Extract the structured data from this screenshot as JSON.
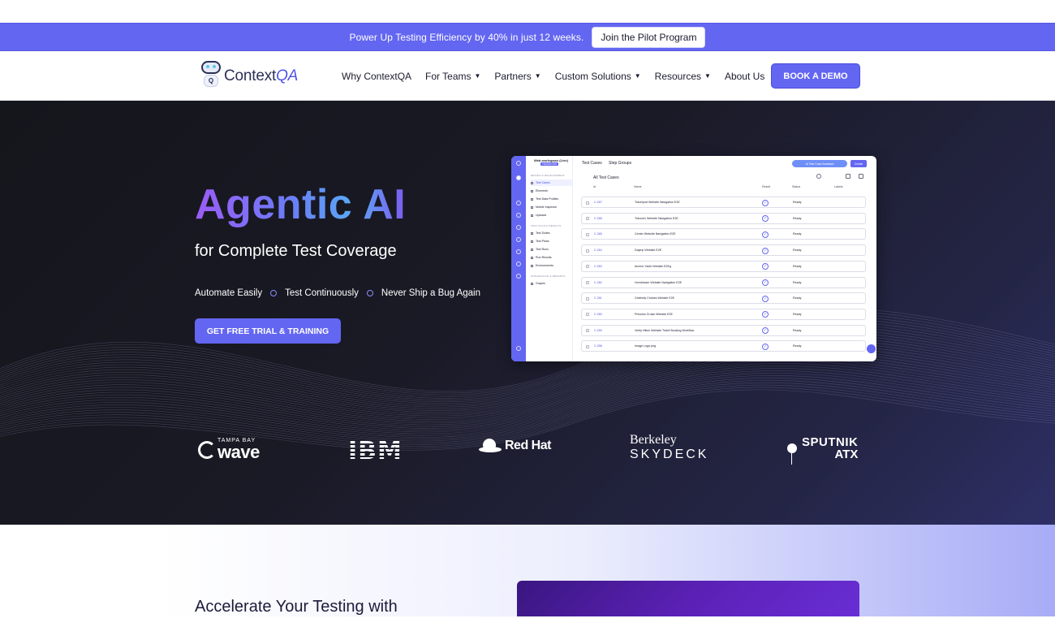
{
  "promo": {
    "text": "Power Up Testing Efficiency by 40% in just 12 weeks.",
    "button": "Join the Pilot Program"
  },
  "nav": {
    "logo_text_1": "Context",
    "logo_text_2": "QA",
    "logo_badge": "Q",
    "links": [
      {
        "label": "Why ContextQA",
        "dropdown": false
      },
      {
        "label": "For Teams",
        "dropdown": true
      },
      {
        "label": "Partners",
        "dropdown": true
      },
      {
        "label": "Custom Solutions",
        "dropdown": true
      },
      {
        "label": "Resources",
        "dropdown": true
      },
      {
        "label": "About Us",
        "dropdown": false
      }
    ],
    "demo_button": "BOOK A DEMO"
  },
  "hero": {
    "title": "Agentic AI",
    "subtitle": "for Complete Test Coverage",
    "points": [
      "Automate Easily",
      "Test Continuously",
      "Never Ship a Bug Again"
    ],
    "cta": "GET FREE TRIAL & TRAINING"
  },
  "app": {
    "workspace": "Web workspace (Live)",
    "workspace_badge": "TRANSITION",
    "tabs": [
      "Test Cases",
      "Step Groups"
    ],
    "ai_button": "AI Test Case Assistant",
    "create_button": "Create",
    "section_1": "DESIGN & DEVELOPMENT",
    "section_1_items": [
      "Test Cases",
      "Elements",
      "Test Data Profiles",
      "Mobile Inspector",
      "Uploads"
    ],
    "section_2": "TEST PLAN & RESULTS",
    "section_2_items": [
      "Test Suites",
      "Test Plans",
      "Test Runs",
      "Run Results",
      "Environments"
    ],
    "section_3": "INTEGRATION & REPORTS",
    "section_3_items": [
      "Graphs"
    ],
    "list_title": "All Test Cases",
    "columns": [
      "Id",
      "Name",
      "Result",
      "Status",
      "Labels"
    ],
    "rows": [
      {
        "id": "C-267",
        "name": "Travelport Website Navigation E2E",
        "status": "Ready"
      },
      {
        "id": "C-266",
        "name": "Travurex Website Navigation E2E",
        "status": "Ready"
      },
      {
        "id": "C-265",
        "name": "Center Website Navigation E2E",
        "status": "Ready"
      },
      {
        "id": "C-264",
        "name": "Daytrip Website E2E",
        "status": "Ready"
      },
      {
        "id": "C-263",
        "name": "Anchor Yacht Website E2Eg",
        "status": "Ready"
      },
      {
        "id": "C-262",
        "name": "Hornblower Website Navigation E2E",
        "status": "Ready"
      },
      {
        "id": "C-261",
        "name": "Celebrity Cruises Website E2E",
        "status": "Ready"
      },
      {
        "id": "C-260",
        "name": "Princess Cruise Website E2E",
        "status": "Ready"
      },
      {
        "id": "C-259",
        "name": "Verify Hilton Website Ticket Booking Workflow",
        "status": "Ready"
      },
      {
        "id": "C-258",
        "name": "Image Logo.png",
        "status": "Ready"
      }
    ],
    "result_icon": "check-circle-icon"
  },
  "logos": {
    "wave_top": "TAMPA BAY",
    "wave_main": "wave",
    "ibm": "IBM",
    "redhat": "Red Hat",
    "berkeley": "Berkeley",
    "skydeck": "SKYDECK",
    "sputnik_1": "SPUTNIK",
    "sputnik_2": "ATX"
  },
  "next": {
    "title": "Accelerate Your Testing with"
  },
  "colors": {
    "brand": "#6366f1",
    "hero_bg": "#15151c"
  }
}
